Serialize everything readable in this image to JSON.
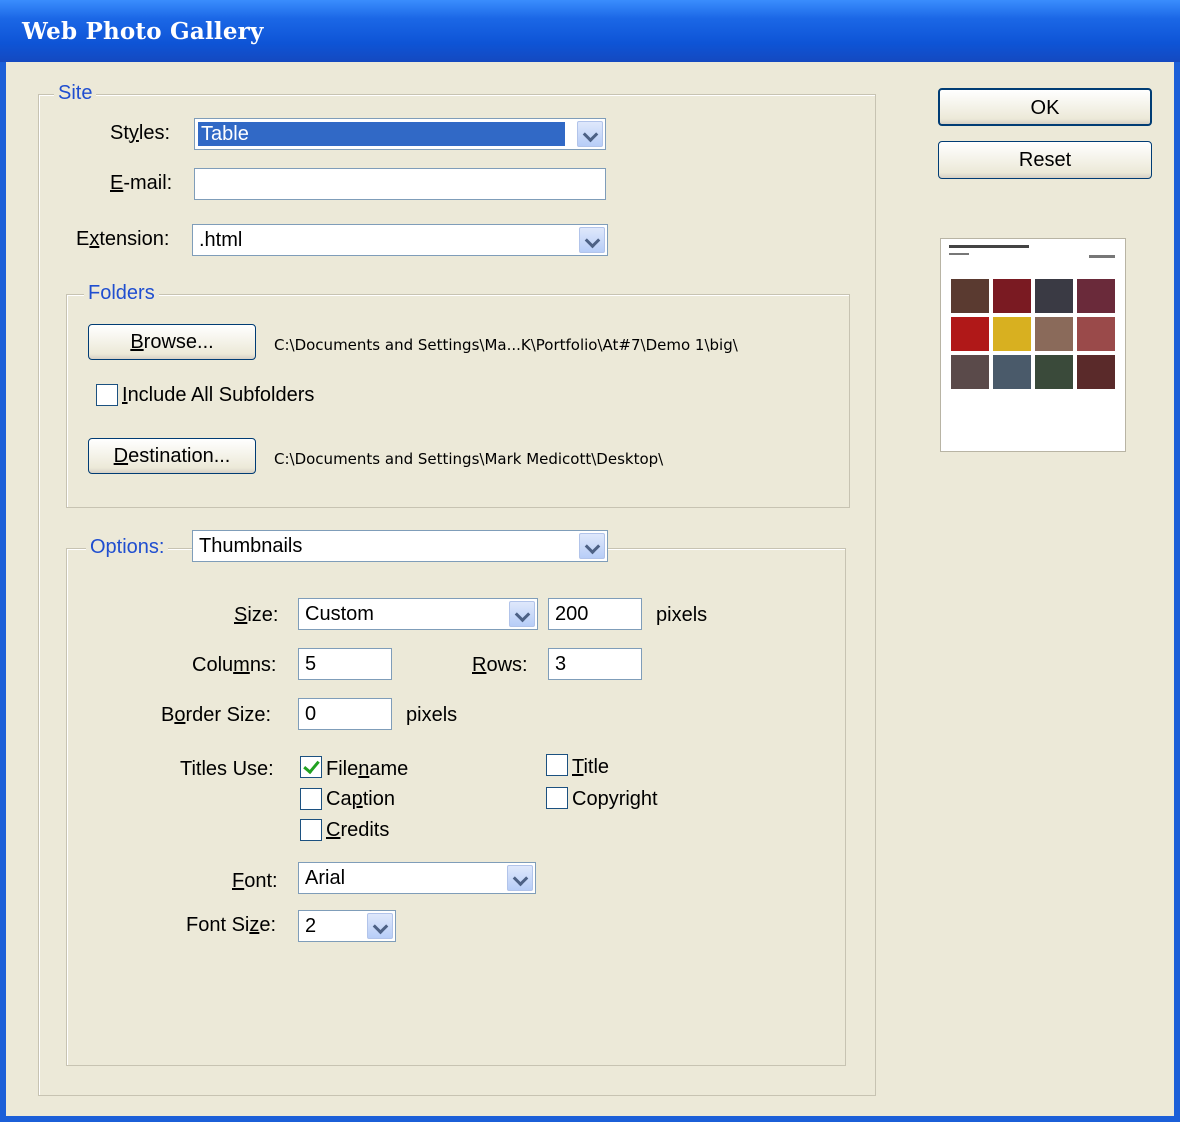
{
  "window": {
    "title": "Web Photo Gallery"
  },
  "buttons": {
    "ok": "OK",
    "reset": "Reset"
  },
  "site": {
    "legend": "Site",
    "styles": {
      "label_pre": "St",
      "label_key": "y",
      "label_post": "les:",
      "value": "Table"
    },
    "email": {
      "label_key": "E",
      "label_post": "-mail:",
      "value": ""
    },
    "extension": {
      "label_pre": "E",
      "label_key": "x",
      "label_post": "tension:",
      "value": ".html"
    },
    "folders": {
      "legend": "Folders",
      "browse": {
        "key": "B",
        "rest": "rowse...",
        "path": "C:\\Documents and Settings\\Ma...K\\Portfolio\\At#7\\Demo 1\\big\\"
      },
      "include_subfolders": {
        "key": "I",
        "rest": "nclude All Subfolders",
        "checked": false
      },
      "destination": {
        "key": "D",
        "rest": "estination...",
        "path": "C:\\Documents and Settings\\Mark Medicott\\Desktop\\"
      }
    }
  },
  "options": {
    "legend": "Options:",
    "section": "Thumbnails",
    "size": {
      "label_key": "S",
      "label_post": "ize:",
      "value": "Custom",
      "pixels_value": "200",
      "unit": "pixels"
    },
    "columns": {
      "label_pre": "Colu",
      "label_key": "m",
      "label_post": "ns:",
      "value": "5"
    },
    "rows": {
      "label_key": "R",
      "label_post": "ows:",
      "value": "3"
    },
    "border": {
      "label_pre": "B",
      "label_key": "o",
      "label_post": "rder Size:",
      "value": "0",
      "unit": "pixels"
    },
    "titles_use": {
      "label": "Titles Use:",
      "filename": {
        "pre": "File",
        "key": "n",
        "post": "ame",
        "checked": true
      },
      "caption": {
        "pre": "Ca",
        "key": "p",
        "post": "tion",
        "checked": false
      },
      "credits": {
        "pre": "",
        "key": "C",
        "post": "redits",
        "checked": false
      },
      "title": {
        "pre": "",
        "key": "T",
        "post": "itle",
        "checked": false
      },
      "copyright": {
        "pre": "Copyri",
        "key": "g",
        "post": "ht",
        "checked": false
      }
    },
    "font": {
      "label_key": "F",
      "label_post": "ont:",
      "value": "Arial"
    },
    "font_size": {
      "label_pre": "Font Si",
      "label_key": "z",
      "label_post": "e:",
      "value": "2"
    }
  }
}
